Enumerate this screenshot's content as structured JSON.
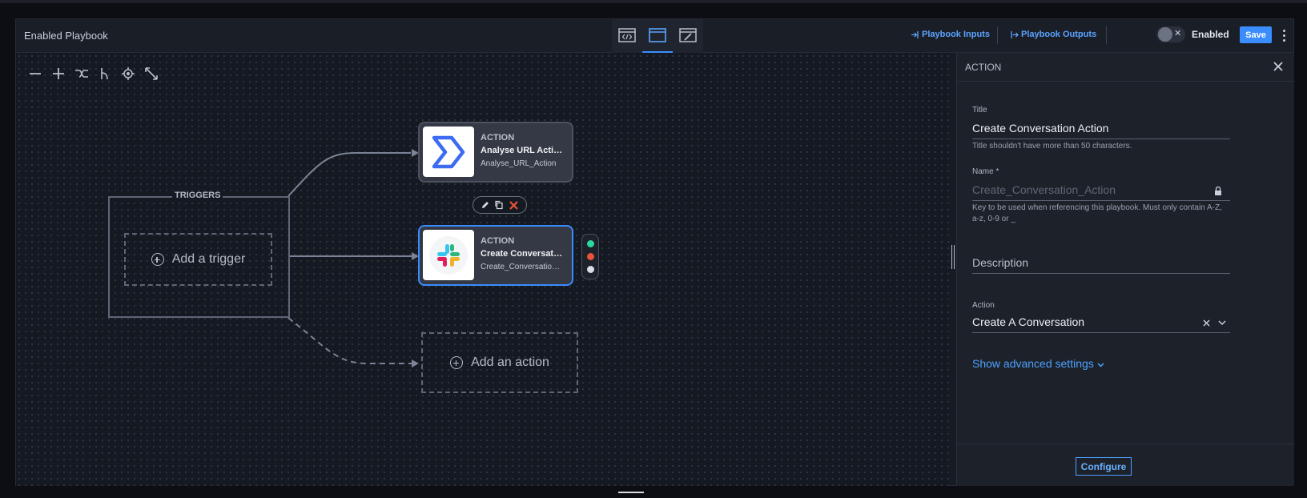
{
  "header": {
    "title": "Enabled Playbook",
    "playbook_inputs": "Playbook Inputs",
    "playbook_outputs": "Playbook Outputs",
    "enabled_label": "Enabled",
    "toggle_mark": "✕",
    "save_label": "Save"
  },
  "canvas": {
    "triggers_label": "TRIGGERS",
    "add_trigger": "Add a trigger",
    "add_action": "Add an action",
    "nodes": [
      {
        "kind": "ACTION",
        "title": "Analyse URL Action",
        "name": "Analyse_URL_Action"
      },
      {
        "kind": "ACTION",
        "title": "Create Conversation Action",
        "name": "Create_Conversation_Action"
      }
    ],
    "status_colors": [
      "#2bd9a0",
      "#e8533a",
      "#d9dde4"
    ]
  },
  "panel": {
    "heading": "ACTION",
    "title_label": "Title",
    "title_value": "Create Conversation Action",
    "title_help": "Title shouldn't have more than 50 characters.",
    "name_label": "Name",
    "name_required": "*",
    "name_placeholder": "Create_Conversation_Action",
    "name_help": "Key to be used when referencing this playbook. Must only contain A-Z, a-z, 0-9 or _",
    "description_placeholder": "Description",
    "action_label": "Action",
    "action_value": "Create A Conversation",
    "advanced_link": "Show advanced settings",
    "configure_button": "Configure"
  },
  "colors": {
    "accent": "#3b8cff",
    "delete": "#e8533a"
  }
}
